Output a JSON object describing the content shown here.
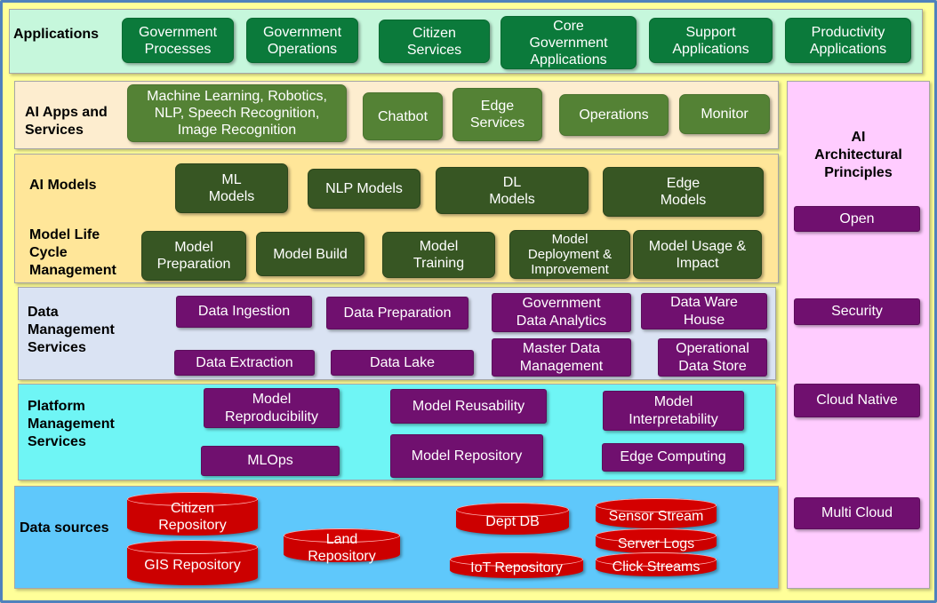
{
  "applications": {
    "label": "Applications",
    "items": [
      "Government\nProcesses",
      "Government\nOperations",
      "Citizen\nServices",
      "Core\nGovernment\nApplications",
      "Support\nApplications",
      "Productivity\nApplications"
    ]
  },
  "ai_apps": {
    "label": "AI Apps and\nServices",
    "items": [
      "Machine Learning, Robotics,\nNLP, Speech Recognition,\nImage Recognition",
      "Chatbot",
      "Edge\nServices",
      "Operations",
      "Monitor"
    ]
  },
  "ai_models": {
    "label": "AI Models",
    "items": [
      "ML\nModels",
      "NLP Models",
      "DL\nModels",
      "Edge\nModels"
    ]
  },
  "lifecycle": {
    "label": "Model Life\nCycle\nManagement",
    "items": [
      "Model\nPreparation",
      "Model Build",
      "Model\nTraining",
      "Model\nDeployment &\nImprovement",
      "Model Usage &\nImpact"
    ]
  },
  "data_management": {
    "label": "Data\nManagement\nServices",
    "items": [
      "Data  Ingestion",
      "Data Preparation",
      "Government\nData Analytics",
      "Data Ware\nHouse",
      "Data Extraction",
      "Data  Lake",
      "Master Data\nManagement",
      "Operational\nData Store"
    ]
  },
  "platform": {
    "label": "Platform\nManagement\nServices",
    "items": [
      "Model\nReproducibility",
      "Model Reusability",
      "Model\nInterpretability",
      "MLOps",
      "Model Repository",
      "Edge  Computing"
    ]
  },
  "data_sources": {
    "label": "Data sources",
    "items": [
      "Citizen\nRepository",
      "GIS Repository",
      "Land\nRepository",
      "Dept DB",
      "IoT Repository",
      "Sensor Stream",
      "Server Logs",
      "Click Streams"
    ]
  },
  "principles": {
    "label": "AI\nArchitectural\nPrinciples",
    "items": [
      "Open",
      "Security",
      "Cloud Native",
      "Multi Cloud"
    ]
  },
  "colors": {
    "app_green": "#0b7a3b",
    "ai_apps_green": "#548235",
    "model_green": "#375623",
    "purple": "#70106f",
    "db_red": "#cc0000",
    "frame_blue": "#4f81bd"
  }
}
